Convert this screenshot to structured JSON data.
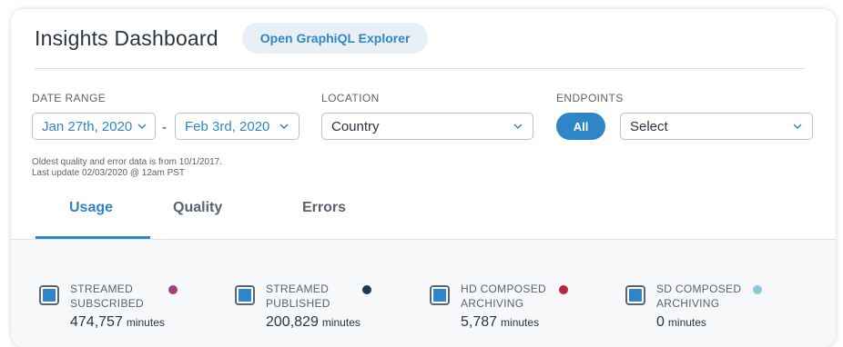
{
  "header": {
    "title": "Insights Dashboard",
    "graphiql_button": "Open GraphiQL Explorer"
  },
  "filters": {
    "date_range": {
      "label": "DATE RANGE",
      "start": "Jan 27th, 2020",
      "separator": "-",
      "end": "Feb 3rd, 2020"
    },
    "location": {
      "label": "LOCATION",
      "value": "Country"
    },
    "endpoints": {
      "label": "ENDPOINTS",
      "all_button": "All",
      "select_value": "Select"
    },
    "note_line1": "Oldest quality and error data is from 10/1/2017.",
    "note_line2": "Last update 02/03/2020 @ 12am PST"
  },
  "tabs": [
    {
      "label": "Usage",
      "active": true
    },
    {
      "label": "Quality",
      "active": false
    },
    {
      "label": "Errors",
      "active": false
    }
  ],
  "stats": [
    {
      "line1": "STREAMED",
      "line2": "SUBSCRIBED",
      "value": "474,757",
      "unit": "minutes",
      "dot_color": "#a3417f"
    },
    {
      "line1": "STREAMED",
      "line2": "PUBLISHED",
      "value": "200,829",
      "unit": "minutes",
      "dot_color": "#1c3853"
    },
    {
      "line1": "HD COMPOSED",
      "line2": "ARCHIVING",
      "value": "5,787",
      "unit": "minutes",
      "dot_color": "#c0213f"
    },
    {
      "line1": "SD COMPOSED",
      "line2": "ARCHIVING",
      "value": "0",
      "unit": "minutes",
      "dot_color": "#8ccbd4"
    }
  ],
  "colors": {
    "accent": "#2f86c6",
    "text_dark": "#2b3444",
    "text_muted": "#5a6270"
  },
  "icons": {
    "dropdown": "chevron-down-icon",
    "stat_toggle": "checkbox-icon"
  }
}
